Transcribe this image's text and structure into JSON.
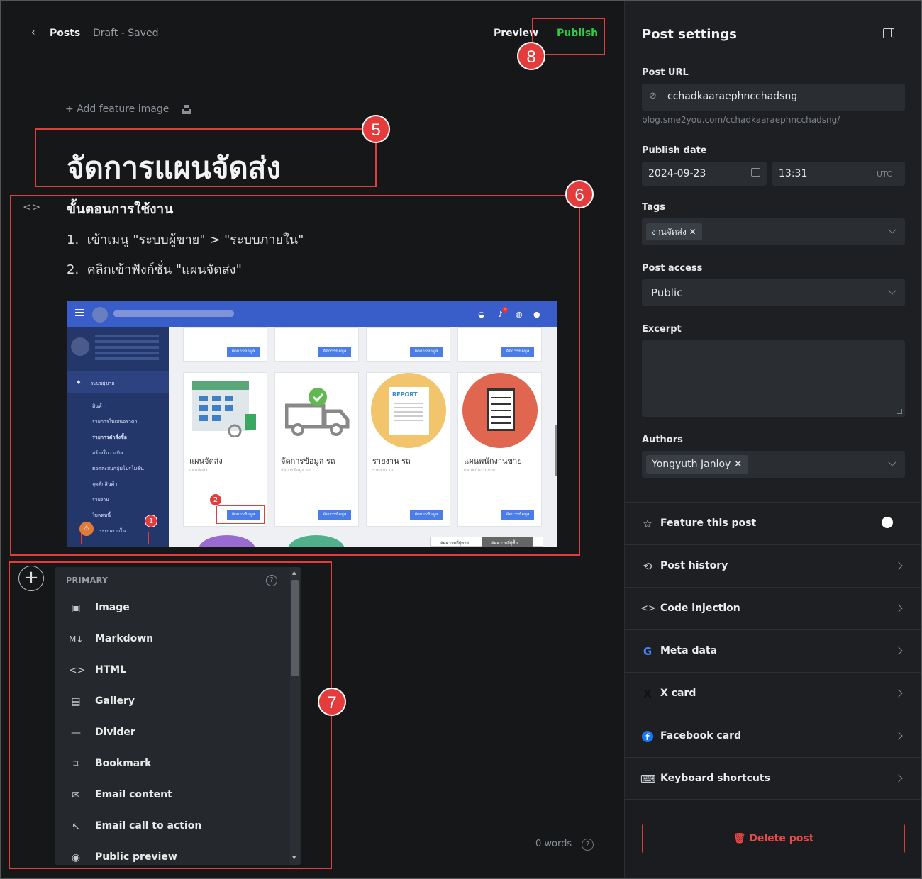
{
  "topbar": {
    "back_label": "Posts",
    "status": "Draft - Saved",
    "preview_label": "Preview",
    "publish_label": "Publish"
  },
  "annotations": [
    "5",
    "6",
    "7",
    "8"
  ],
  "editor": {
    "add_feature_image": "Add feature image",
    "title": "จัดการแผนจัดส่ง",
    "heading": "ขั้นตอนการใช้งาน",
    "steps": [
      {
        "num": "1.",
        "text": "เข้าเมนู \"ระบบผู้ขาย\" > \"ระบบภายใน\""
      },
      {
        "num": "2.",
        "text": "คลิกเข้าฟังก์ชั่น \"แผนจัดส่ง\""
      }
    ],
    "word_count": "0 words"
  },
  "screenshot": {
    "cards": [
      {
        "title": "แผนจัดส่ง",
        "sub": "แผนจัดส่ง",
        "button": "จัดการข้อมูล"
      },
      {
        "title": "จัดการข้อมูล รถ",
        "sub": "จัดการข้อมูล รถ",
        "button": "จัดการข้อมูล"
      },
      {
        "title": "รายงาน รถ",
        "sub": "รายงาน รถ",
        "button": "จัดการข้อมูล"
      },
      {
        "title": "แผนพนักงานขาย",
        "sub": "แผนพนักงานขาย",
        "button": "จัดการข้อมูล"
      }
    ],
    "top_button": "จัดการข้อมูล",
    "report_label": "REPORT",
    "nav_items": [
      "ระบบผู้ขาย",
      "สินค้า",
      "รายการใบเสนอราคา",
      "รายการคำสั่งซื้อ",
      "สร้างใบวางบิล",
      "ยอดละสมกลุ่มโปรโมชั่น",
      "จุดพักสินค้า",
      "รายงาน",
      "ใบลดหนี้",
      "ระบบภายใน"
    ],
    "markers": [
      "1",
      "2"
    ],
    "badge": "1",
    "footer_tabs": [
      "จัดความถี่ผู้ขาย",
      "จัดความถี่ผู้ซื้อ"
    ]
  },
  "insert_menu": {
    "section": "PRIMARY",
    "items": [
      {
        "label": "Image",
        "icon": "image-icon",
        "glyph": "▣"
      },
      {
        "label": "Markdown",
        "icon": "markdown-icon",
        "glyph": "M↓"
      },
      {
        "label": "HTML",
        "icon": "code-icon",
        "glyph": "<>"
      },
      {
        "label": "Gallery",
        "icon": "gallery-icon",
        "glyph": "▤"
      },
      {
        "label": "Divider",
        "icon": "divider-icon",
        "glyph": "—"
      },
      {
        "label": "Bookmark",
        "icon": "bookmark-icon",
        "glyph": "⌑"
      },
      {
        "label": "Email content",
        "icon": "envelope-icon",
        "glyph": "✉"
      },
      {
        "label": "Email call to action",
        "icon": "cursor-icon",
        "glyph": "↖"
      },
      {
        "label": "Public preview",
        "icon": "eye-icon",
        "glyph": "◉"
      }
    ]
  },
  "sidebar": {
    "title": "Post settings",
    "post_url_label": "Post URL",
    "post_url": "cchadkaaraephncchadsng",
    "url_hint": "blog.sme2you.com/cchadkaaraephncchadsng/",
    "publish_date_label": "Publish date",
    "date": "2024-09-23",
    "time": "13:31",
    "timezone": "UTC",
    "tags_label": "Tags",
    "tag": "งานจัดส่ง",
    "access_label": "Post access",
    "access": "Public",
    "excerpt_label": "Excerpt",
    "authors_label": "Authors",
    "author": "Yongyuth Janloy",
    "rows": [
      {
        "label": "Feature this post",
        "icon": "star-icon",
        "glyph": "☆"
      },
      {
        "label": "Post history",
        "icon": "history-icon",
        "glyph": "⟲"
      },
      {
        "label": "Code injection",
        "icon": "code-icon",
        "glyph": "<>"
      },
      {
        "label": "Meta data",
        "icon": "google-icon",
        "glyph": "G"
      },
      {
        "label": "X card",
        "icon": "x-icon",
        "glyph": "X"
      },
      {
        "label": "Facebook card",
        "icon": "facebook-icon",
        "glyph": "f"
      },
      {
        "label": "Keyboard shortcuts",
        "icon": "keyboard-icon",
        "glyph": "⌨"
      }
    ],
    "delete_label": "Delete post"
  },
  "colors": {
    "accent_green": "#30cf43",
    "annotation_red": "#e43c3c",
    "danger": "#e84848"
  }
}
